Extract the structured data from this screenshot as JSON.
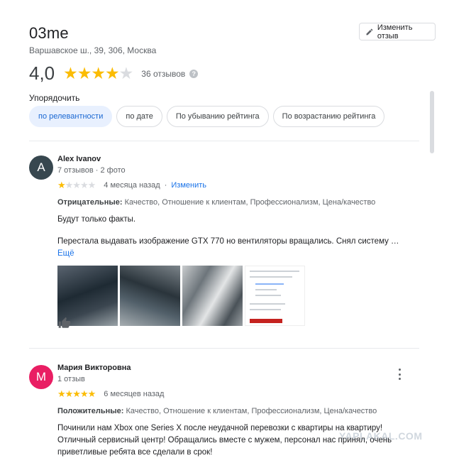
{
  "header": {
    "name": "03me",
    "address": "Варшавское ш., 39, 306, Москва",
    "edit_button": "Изменить отзыв"
  },
  "summary": {
    "rating": "4,0",
    "stars": 4,
    "count": "36 отзывов"
  },
  "sort": {
    "label": "Упорядочить",
    "options": [
      "по релевантности",
      "по дате",
      "По убыванию рейтинга",
      "По возрастанию рейтинга"
    ],
    "active": 0
  },
  "reviews": [
    {
      "initial": "A",
      "avatar_color": "#37474f",
      "author": "Alex Ivanov",
      "meta": "7 отзывов · 2 фото",
      "stars": 1,
      "when": "4 месяца назад",
      "edit_link": "Изменить",
      "aspects_label": "Отрицательные:",
      "aspects": "Качество, Отношение к клиентам, Профессионализм, Цена/качество",
      "text1": "Будут только факты.",
      "text2": "Перестала выдавать изображение GTX 770 но вентиляторы вращались.  Снял систему …",
      "more": "Ещё"
    },
    {
      "initial": "М",
      "avatar_color": "#e91e63",
      "author": "Мария Викторовна",
      "meta": "1 отзыв",
      "stars": 5,
      "when": "6 месяцев назад",
      "aspects_label": "Положительные:",
      "aspects": "Качество, Отношение к клиентам, Профессионализм, Цена/качество",
      "text1": "Починили нам Xbox one Series X после неудачной перевозки с квартиры на квартиру!Отличный сервисный центр! Обращались вместе с мужем, персонал нас принял, очень приветливые ребята все сделали в срок!"
    }
  ],
  "watermark": "YAPLAKAL.COM",
  "colors": {
    "accent": "#1a73e8",
    "star": "#fbbc04",
    "chip_active_bg": "#e8f0fe"
  }
}
